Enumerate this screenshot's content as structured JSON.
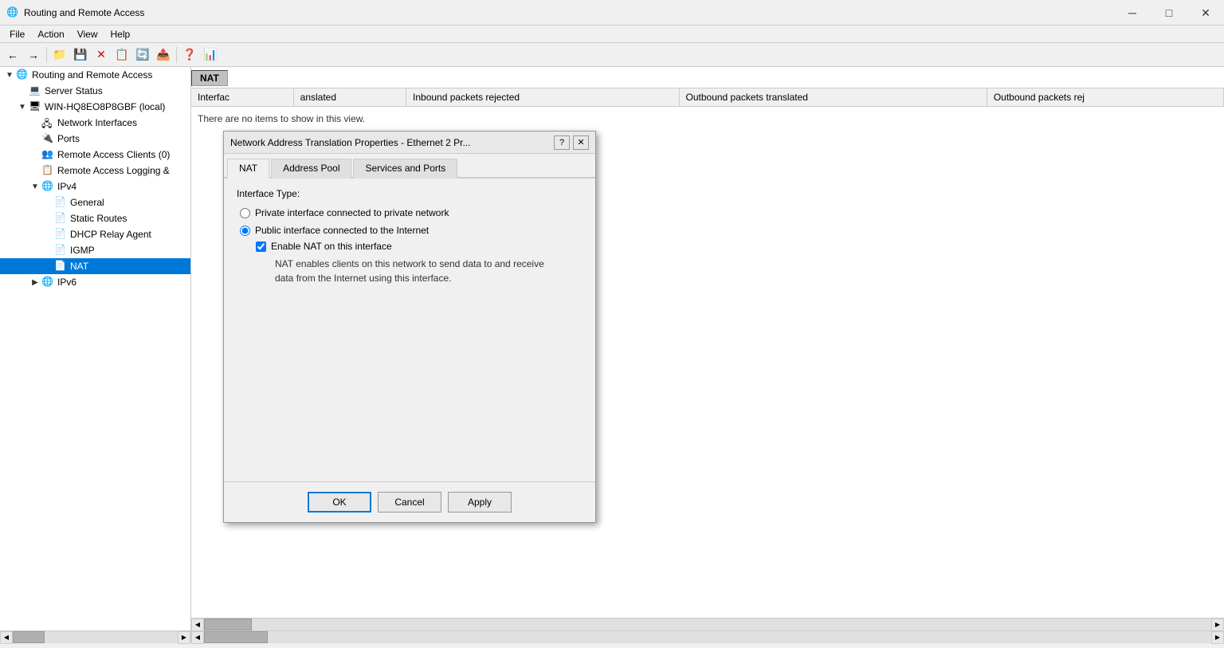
{
  "app": {
    "title": "Routing and Remote Access",
    "icon": "🌐"
  },
  "titlebar": {
    "minimize": "─",
    "maximize": "□",
    "close": "✕"
  },
  "menu": {
    "items": [
      "File",
      "Action",
      "View",
      "Help"
    ]
  },
  "toolbar": {
    "buttons": [
      "←",
      "→",
      "📁",
      "💾",
      "✕",
      "📋",
      "🔄",
      "📤",
      "❓",
      "📊"
    ]
  },
  "sidebar": {
    "items": [
      {
        "label": "Routing and Remote Access",
        "level": 0,
        "expand": "▼",
        "icon": "🌐",
        "selected": false
      },
      {
        "label": "Server Status",
        "level": 1,
        "expand": " ",
        "icon": "💻",
        "selected": false
      },
      {
        "label": "WIN-HQ8EO8P8GBF (local)",
        "level": 1,
        "expand": "▼",
        "icon": "🖥",
        "selected": false
      },
      {
        "label": "Network Interfaces",
        "level": 2,
        "expand": " ",
        "icon": "🖧",
        "selected": false
      },
      {
        "label": "Ports",
        "level": 2,
        "expand": " ",
        "icon": "🔌",
        "selected": false
      },
      {
        "label": "Remote Access Clients (0)",
        "level": 2,
        "expand": " ",
        "icon": "👥",
        "selected": false
      },
      {
        "label": "Remote Access Logging &",
        "level": 2,
        "expand": " ",
        "icon": "📋",
        "selected": false
      },
      {
        "label": "IPv4",
        "level": 2,
        "expand": "▼",
        "icon": "🌐",
        "selected": false
      },
      {
        "label": "General",
        "level": 3,
        "expand": " ",
        "icon": "📄",
        "selected": false
      },
      {
        "label": "Static Routes",
        "level": 3,
        "expand": " ",
        "icon": "📄",
        "selected": false
      },
      {
        "label": "DHCP Relay Agent",
        "level": 3,
        "expand": " ",
        "icon": "📄",
        "selected": false
      },
      {
        "label": "IGMP",
        "level": 3,
        "expand": " ",
        "icon": "📄",
        "selected": false
      },
      {
        "label": "NAT",
        "level": 3,
        "expand": " ",
        "icon": "📄",
        "selected": true
      },
      {
        "label": "IPv6",
        "level": 2,
        "expand": "▶",
        "icon": "🌐",
        "selected": false
      }
    ]
  },
  "content": {
    "nat_label": "NAT",
    "interface_col": "Interfac",
    "columns": [
      "Interfac",
      "anslated",
      "Inbound packets rejected",
      "Outbound packets translated",
      "Outbound packets rej"
    ],
    "empty_message": "There are no items to show in this view."
  },
  "dialog": {
    "title": "Network Address Translation Properties - Ethernet 2 Pr...",
    "tabs": [
      "NAT",
      "Address Pool",
      "Services and Ports"
    ],
    "active_tab": 0,
    "interface_type_label": "Interface Type:",
    "radio_options": [
      {
        "label": "Private interface connected to private network",
        "selected": false
      },
      {
        "label": "Public interface connected to the Internet",
        "selected": true
      }
    ],
    "checkbox_label": "Enable NAT on this interface",
    "checkbox_checked": true,
    "nat_description": "NAT enables clients on this network to send data to and receive\ndata from the Internet using this interface.",
    "buttons": {
      "ok": "OK",
      "cancel": "Cancel",
      "apply": "Apply"
    }
  }
}
